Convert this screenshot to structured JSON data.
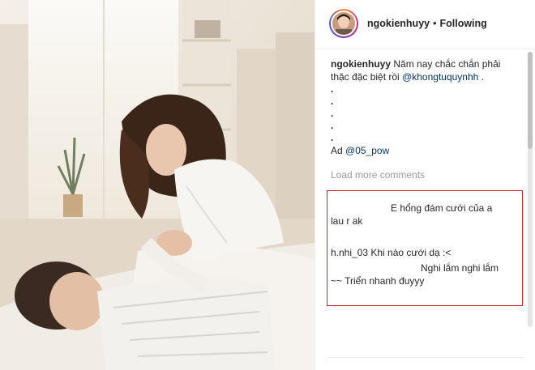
{
  "post": {
    "image_alt": "Couple photo in a bright bedroom"
  },
  "header": {
    "username": "ngokienhuyy",
    "separator": "•",
    "follow_status": "Following"
  },
  "caption": {
    "username": "ngokienhuyy",
    "text_part1": "Năm nay chắc chắn phải thặc đặc biệt rồi",
    "mention": "@khongtuquynhh",
    "text_part2": " .",
    "dots": [
      ".",
      ".",
      ".",
      ".",
      "."
    ],
    "ad_label": "Ad",
    "ad_mention": "@05_pow"
  },
  "load_more": "Load more comments",
  "highlighted_comments": {
    "line1": "E hổng đám cưới của a",
    "line2": "lau r ak",
    "line3": "h.nhi_03 Khi nào cưới dạ :<",
    "line4": "Nghi lắm nghi lắm",
    "line5": "~~ Triển nhanh đuyyy"
  },
  "colors": {
    "highlight_border": "#d0202a",
    "mention": "#003569",
    "muted": "#999999"
  }
}
